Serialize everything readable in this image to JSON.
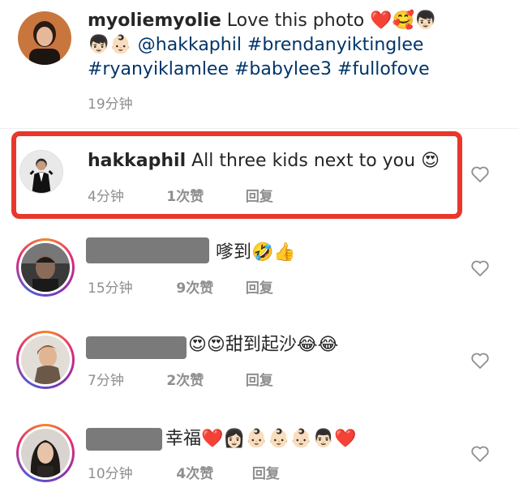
{
  "post_comment": {
    "username": "myoliemyolie",
    "text": "Love this photo",
    "emojis_line1": "❤️🥰👦🏻",
    "emojis_line2": "👦🏻👶🏻",
    "tags_line2": "@hakkaphil #brendanyiktinglee",
    "tags_line3": "#ryanyiklamlee #babylee3 #fullofove",
    "time": "19分钟"
  },
  "comments": [
    {
      "username": "hakkaphil",
      "text": "All three kids next to you",
      "emoji": "😍",
      "time": "4分钟",
      "likes": "1次赞",
      "reply": "回复"
    },
    {
      "username": "",
      "text": "嗲到",
      "emoji": "🤣👍",
      "time": "15分钟",
      "likes": "9次赞",
      "reply": "回复"
    },
    {
      "username": "",
      "text_pre": "😍😍",
      "text": "甜到起沙",
      "emoji": "😂😂",
      "time": "7分钟",
      "likes": "2次赞",
      "reply": "回复"
    },
    {
      "username": "",
      "text": "幸福",
      "emoji": "❤️👩🏻👶🏻👶🏻👶🏻👨🏻❤️",
      "time": "10分钟",
      "likes": "4次赞",
      "reply": "回复"
    }
  ],
  "colors": {
    "highlight": "#e8372b",
    "hashtag": "#003569",
    "meta": "#8e8e8e"
  }
}
